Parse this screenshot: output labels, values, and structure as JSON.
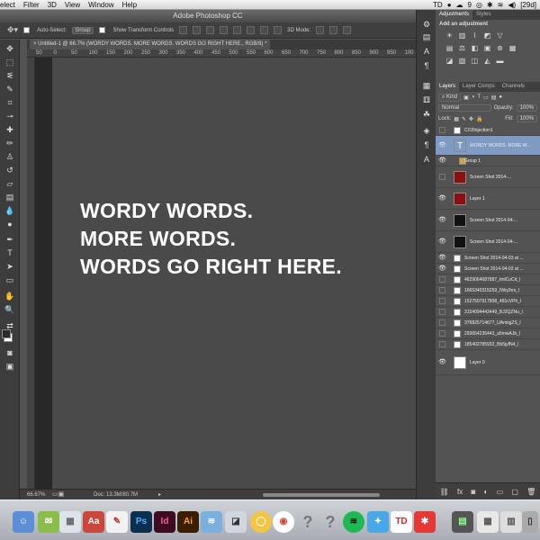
{
  "menubar": {
    "items": [
      "elect",
      "Filter",
      "3D",
      "View",
      "Window",
      "Help"
    ],
    "right": [
      "TD",
      "●",
      "☁",
      "9",
      "◎",
      "✱",
      "≋",
      "◀)",
      "[29d]"
    ]
  },
  "window": {
    "title": "Adobe Photoshop CC"
  },
  "options": {
    "auto_select_label": "Auto-Select:",
    "auto_select_value": "Group",
    "transform_label": "Show Transform Controls",
    "mode_3d": "3D Mode:"
  },
  "document": {
    "tab": "Untitled-1 @ 66.7% (WORDY WORDS.  MORE WORDS.  WORDS GO RIGHT HERE., RGB/8) *"
  },
  "ruler": {
    "ticks": [
      "50",
      "0",
      "50",
      "100",
      "150",
      "200",
      "250",
      "300",
      "350",
      "400",
      "450",
      "500",
      "550",
      "600",
      "650",
      "700",
      "750",
      "800",
      "850",
      "900",
      "950",
      "100"
    ]
  },
  "canvas": {
    "lines": [
      "WORDY WORDS.",
      "MORE WORDS.",
      "WORDS GO RIGHT HERE."
    ]
  },
  "status": {
    "zoom": "66.67%",
    "doc": "Doc: 13.3M/80.7M"
  },
  "adjustments": {
    "tabs": [
      "Adjustments",
      "Styles"
    ],
    "heading": "Add an adjustment"
  },
  "layers": {
    "tabs": [
      "Layers",
      "Layer Comps",
      "Channels"
    ],
    "kind": "Kind",
    "blend": "Normal",
    "opacity_label": "Opacity:",
    "opacity": "100%",
    "lock_label": "Lock:",
    "fill_label": "Fill:",
    "fill": "100%",
    "rows": [
      {
        "name": "CO2Injection1",
        "visible": false,
        "selected": false
      },
      {
        "name": "WORDY WORDS.  MORE W...",
        "visible": true,
        "selected": true
      },
      {
        "name": "Group 1",
        "visible": true,
        "selected": false
      },
      {
        "name": "Screen Shot 2014-...",
        "visible": false,
        "selected": false
      },
      {
        "name": "Layer 1",
        "visible": true,
        "selected": false
      },
      {
        "name": "Screen Shot 2014-04-...",
        "visible": true,
        "selected": false
      },
      {
        "name": "Screen Shot 2014-04-...",
        "visible": true,
        "selected": false
      },
      {
        "name": "Screen Shot 2014-04-03 at ...",
        "visible": true,
        "selected": false
      },
      {
        "name": "Screen Shot 2014-04-02 at ...",
        "visible": true,
        "selected": false
      },
      {
        "name": "4629064687887_tmlCuCd_l",
        "visible": false,
        "selected": false
      },
      {
        "name": "1665340315259_IWqJhrs_l",
        "visible": false,
        "selected": false
      },
      {
        "name": "1527507917808_481cVPh_l",
        "visible": false,
        "selected": false
      },
      {
        "name": "3154094443449_BJ2QZNu_l",
        "visible": false,
        "selected": false
      },
      {
        "name": "376825714677_UAmlqjZS_l",
        "visible": false,
        "selected": false
      },
      {
        "name": "293654235443_a5mwAJb_l",
        "visible": false,
        "selected": false
      },
      {
        "name": "185402785932_Bb5jyfN4_l",
        "visible": false,
        "selected": false
      },
      {
        "name": "Layer 0",
        "visible": true,
        "selected": false
      }
    ]
  },
  "colors": {
    "selected_row": "#7f9ac3",
    "canvas": "#4a4a4a",
    "chrome": "#3c3c3c"
  }
}
